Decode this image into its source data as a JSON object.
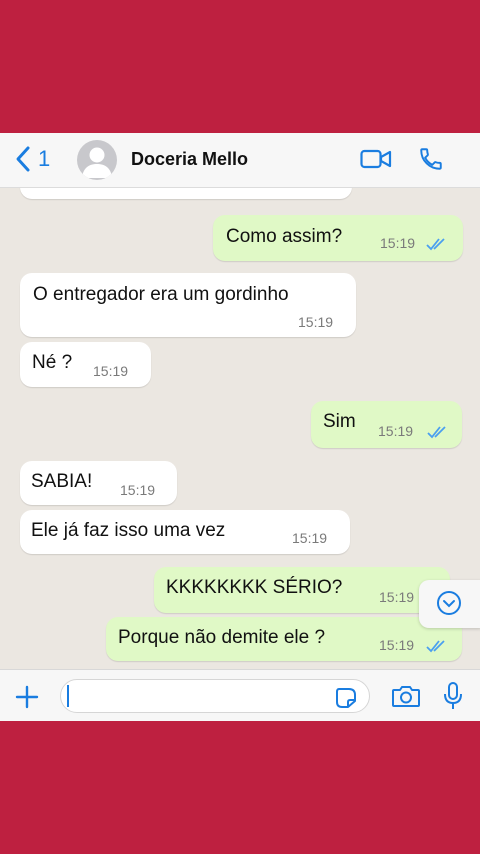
{
  "header": {
    "back_count": "1",
    "contact_name": "Doceria Mello"
  },
  "messages": [
    {
      "direction": "out",
      "text": "Como assim?",
      "time": "15:19",
      "read": true
    },
    {
      "direction": "in",
      "text": "O entregador era um gordinho",
      "time": "15:19"
    },
    {
      "direction": "in",
      "text": "Né ?",
      "time": "15:19"
    },
    {
      "direction": "out",
      "text": "Sim",
      "time": "15:19",
      "read": true
    },
    {
      "direction": "in",
      "text": "SABIA!",
      "time": "15:19"
    },
    {
      "direction": "in",
      "text": "Ele já faz isso uma vez",
      "time": "15:19"
    },
    {
      "direction": "out",
      "text": "KKKKKKKK SÉRIO?",
      "time": "15:19",
      "read": true
    },
    {
      "direction": "out",
      "text": "Porque não demite ele ?",
      "time": "15:19",
      "read": true
    }
  ],
  "colors": {
    "frame": "#be2040",
    "accent": "#1a7de0",
    "outgoing_bubble": "#e0f9c6",
    "incoming_bubble": "#ffffff",
    "chat_background": "#ebe7e1"
  },
  "icons": {
    "back": "chevron-left-icon",
    "avatar": "default-avatar-icon",
    "video": "video-camera-icon",
    "call": "phone-icon",
    "scroll": "chevron-down-icon",
    "attach": "plus-icon",
    "sticker": "sticker-icon",
    "camera": "camera-icon",
    "mic": "microphone-icon"
  }
}
